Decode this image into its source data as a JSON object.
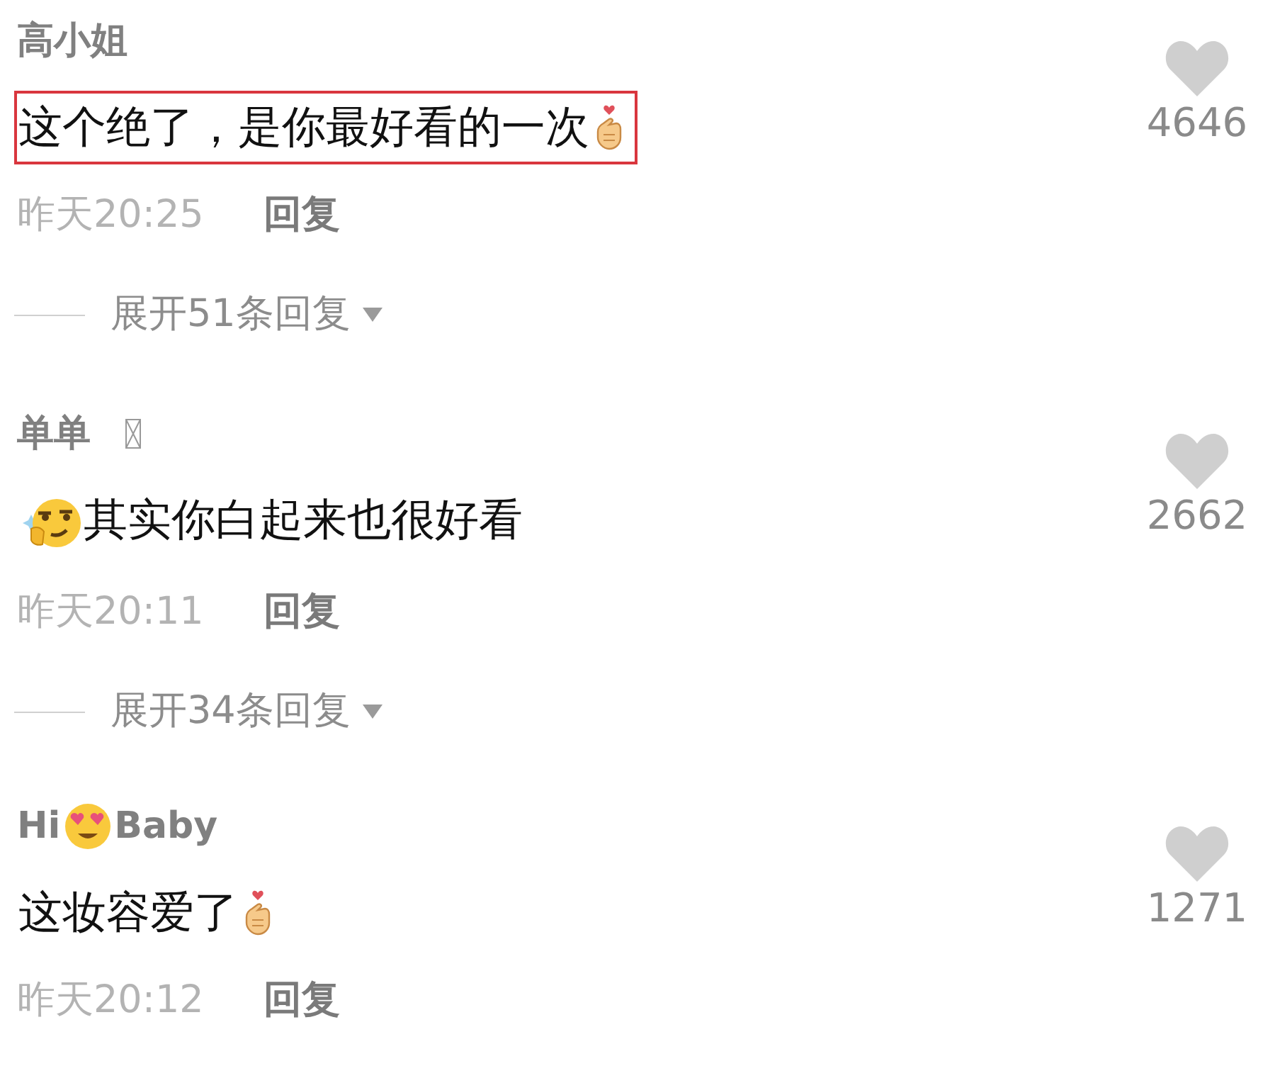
{
  "comments": [
    {
      "name_parts": [
        {
          "kind": "text",
          "text": "高小姐"
        }
      ],
      "body_parts": [
        {
          "kind": "text",
          "text": "这个绝了，是你最好看的一次"
        },
        {
          "kind": "finger-heart"
        }
      ],
      "highlighted": true,
      "time": "昨天20:25",
      "reply": "回复",
      "expand": "展开51条回复",
      "likes": "4646"
    },
    {
      "name_parts": [
        {
          "kind": "text",
          "text": "单单"
        },
        {
          "kind": "missing-glyph"
        }
      ],
      "body_parts": [
        {
          "kind": "thinking-face"
        },
        {
          "kind": "text",
          "text": "其实你白起来也很好看"
        }
      ],
      "highlighted": false,
      "time": "昨天20:11",
      "reply": "回复",
      "expand": "展开34条回复",
      "likes": "2662"
    },
    {
      "name_parts": [
        {
          "kind": "text",
          "text": "Hi"
        },
        {
          "kind": "heart-eyes-face"
        },
        {
          "kind": "text",
          "text": "Baby"
        }
      ],
      "body_parts": [
        {
          "kind": "text",
          "text": "这妆容爱了"
        },
        {
          "kind": "finger-heart"
        }
      ],
      "highlighted": false,
      "time": "昨天20:12",
      "reply": "回复",
      "likes": "1271"
    }
  ]
}
